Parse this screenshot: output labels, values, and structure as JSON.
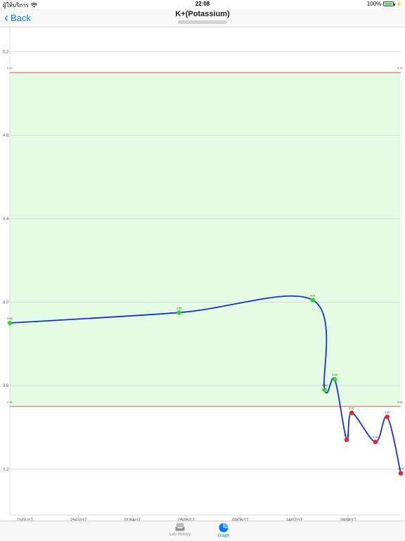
{
  "status": {
    "carrier": "ผู้ให้บริการ",
    "time": "22:08",
    "battery": "100%"
  },
  "nav": {
    "back_label": "Back",
    "title": "K+(Potassium)"
  },
  "tabs": [
    {
      "label": "Lab History",
      "icon": "inbox-icon"
    },
    {
      "label": "Graph",
      "icon": "pie-chart-icon"
    }
  ],
  "colors": {
    "accent": "#007aff",
    "line": "#1133dd",
    "normal_band": "#e6fbe4",
    "limit_line": "#e05050",
    "point_normal": "#22dd22",
    "point_low": "#ee2222"
  },
  "chart_data": {
    "type": "line",
    "ylim": [
      2.98,
      5.32
    ],
    "yticks": [
      "3.2",
      "3.6",
      "4.0",
      "4.4",
      "4.8",
      "5.2"
    ],
    "xticks": [
      "21/01/17",
      "25/02/17",
      "01/04/17",
      "05/05/17",
      "09/06/17",
      "14/07/17",
      "18/08/17"
    ],
    "upper_limit": {
      "value": 5.1,
      "label": "5.10"
    },
    "lower_limit": {
      "value": 3.5,
      "label": "3.50"
    },
    "series": [
      {
        "values": [
          {
            "x": "2017-01-20",
            "y": 3.9,
            "label": "3.90"
          },
          {
            "x": "2017-04-30",
            "y": 3.95,
            "label": "3.95"
          },
          {
            "x": "2017-07-18",
            "y": 4.01,
            "label": "4.01"
          },
          {
            "x": "2017-07-25",
            "y": 3.58,
            "label": "3.58"
          },
          {
            "x": "2017-07-31",
            "y": 3.63,
            "label": "3.63"
          },
          {
            "x": "2017-08-07",
            "y": 3.34,
            "label": "3.34"
          },
          {
            "x": "2017-08-10",
            "y": 3.47,
            "label": "3.47"
          },
          {
            "x": "2017-08-24",
            "y": 3.33,
            "label": "3.33"
          },
          {
            "x": "2017-08-31",
            "y": 3.45,
            "label": "3.45"
          },
          {
            "x": "2017-09-08",
            "y": 3.18,
            "label": "3.18"
          }
        ]
      }
    ]
  }
}
